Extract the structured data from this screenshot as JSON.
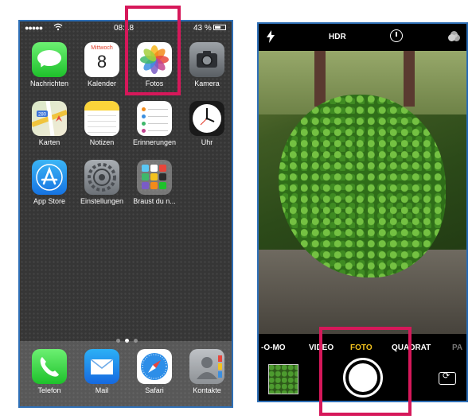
{
  "home_screen": {
    "status_bar": {
      "signal": "●●●●●",
      "time": "08:18",
      "battery": "43 %"
    },
    "apps": [
      {
        "label": "Nachrichten",
        "icon": "messages-icon"
      },
      {
        "label": "Kalender",
        "icon": "calendar-icon",
        "weekday": "Mittwoch",
        "date": "8"
      },
      {
        "label": "Fotos",
        "icon": "photos-icon"
      },
      {
        "label": "Kamera",
        "icon": "camera-icon"
      },
      {
        "label": "Karten",
        "icon": "maps-icon",
        "badge": "280"
      },
      {
        "label": "Notizen",
        "icon": "notes-icon"
      },
      {
        "label": "Erinnerungen",
        "icon": "reminders-icon"
      },
      {
        "label": "Uhr",
        "icon": "clock-icon"
      },
      {
        "label": "App Store",
        "icon": "app-store-icon"
      },
      {
        "label": "Einstellungen",
        "icon": "settings-icon"
      },
      {
        "label": "Braust du n...",
        "icon": "folder-icon"
      }
    ],
    "dock": [
      {
        "label": "Telefon",
        "icon": "phone-icon"
      },
      {
        "label": "Mail",
        "icon": "mail-icon"
      },
      {
        "label": "Safari",
        "icon": "safari-icon"
      },
      {
        "label": "Kontakte",
        "icon": "contacts-icon"
      }
    ]
  },
  "camera": {
    "top_bar": {
      "hdr": "HDR"
    },
    "modes": [
      "-O-MO",
      "VIDEO",
      "FOTO",
      "QUADRAT",
      "PA"
    ],
    "active_mode": "FOTO"
  },
  "colors": {
    "highlight": "#d6185a",
    "frame": "#2e6fb6",
    "active_mode": "#f3c21e"
  }
}
